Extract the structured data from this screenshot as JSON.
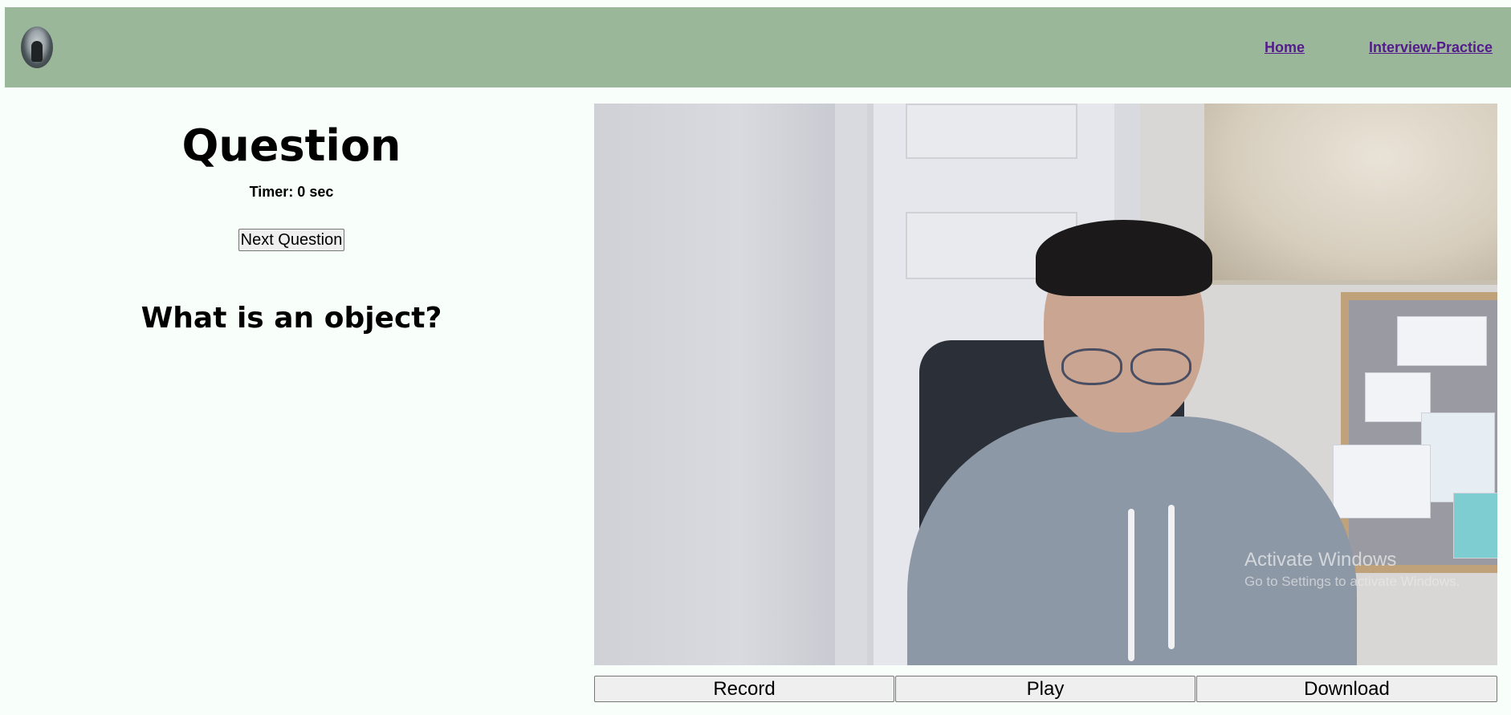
{
  "header": {
    "logo_icon": "avatar-logo-icon",
    "nav": {
      "home": "Home",
      "interview_practice": "Interview-Practice"
    },
    "background_color": "#9ab899",
    "link_color": "#551a8b"
  },
  "left": {
    "title": "Question",
    "timer": "Timer: 0 sec",
    "next_button": "Next Question",
    "question": "What is an object?"
  },
  "video": {
    "watermark_title": "Activate Windows",
    "watermark_subtitle": "Go to Settings to activate Windows."
  },
  "controls": {
    "record": "Record",
    "play": "Play",
    "download": "Download"
  }
}
